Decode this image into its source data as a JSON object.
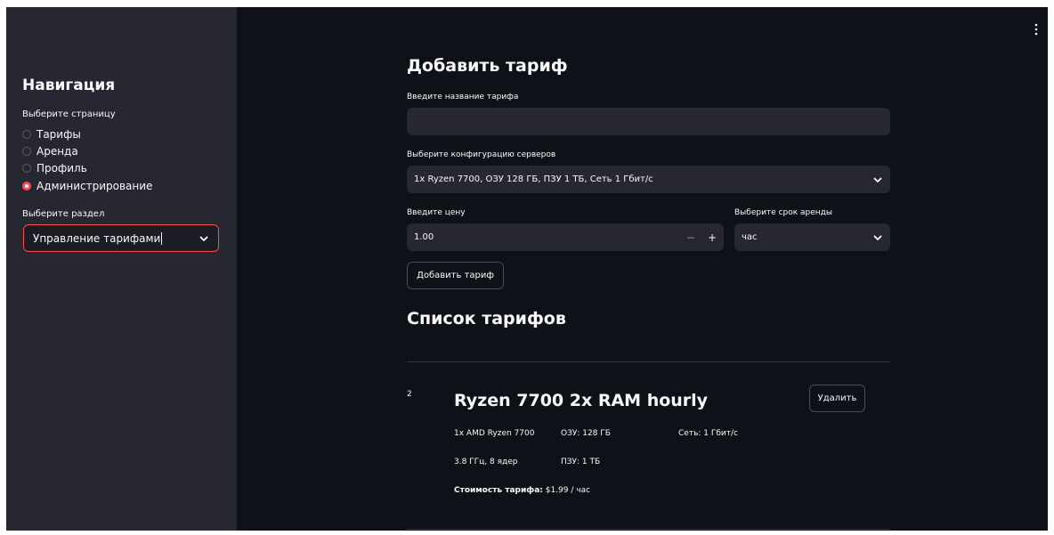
{
  "sidebar": {
    "title": "Навигация",
    "page_label": "Выберите страницу",
    "pages": [
      {
        "label": "Тарифы",
        "selected": false
      },
      {
        "label": "Аренда",
        "selected": false
      },
      {
        "label": "Профиль",
        "selected": false
      },
      {
        "label": "Администрирование",
        "selected": true
      }
    ],
    "section_label": "Выберите раздел",
    "section_value": "Управление тарифами"
  },
  "form": {
    "title": "Добавить тариф",
    "name_label": "Введите название тарифа",
    "name_value": "",
    "config_label": "Выберите конфигурацию серверов",
    "config_value": "1x Ryzen 7700, ОЗУ 128 ГБ, ПЗУ 1 ТБ, Сеть 1 Гбит/с",
    "price_label": "Введите цену",
    "price_value": "1.00",
    "minus": "−",
    "plus": "+",
    "period_label": "Выберите срок аренды",
    "period_value": "час",
    "submit_label": "Добавить тариф"
  },
  "list": {
    "title": "Список тарифов",
    "items": [
      {
        "id": "2",
        "name": "Ryzen 7700 2x RAM hourly",
        "delete_label": "Удалить",
        "cpu": "1x AMD Ryzen 7700",
        "cpu_spec": "3.8 ГГц, 8 ядер",
        "ram": "ОЗУ: 128 ГБ",
        "storage": "ПЗУ: 1 ТБ",
        "network": "Сеть: 1 Гбит/с",
        "price_label": "Стоимость тарифа:",
        "price_value": " $1.99 / час"
      }
    ]
  },
  "colors": {
    "accent": "#ff4b4b",
    "background": "#0e1117",
    "sidebar": "#262730"
  }
}
